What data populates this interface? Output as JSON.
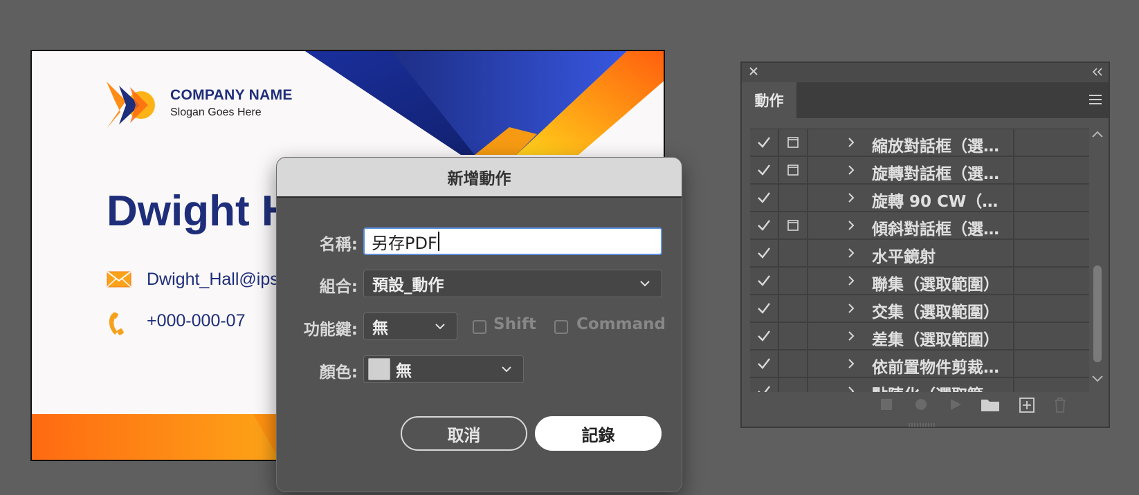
{
  "card": {
    "company_name": "COMPANY NAME",
    "slogan": "Slogan Goes Here",
    "person_name": "Dwight H",
    "email": "Dwight_Hall@ips",
    "phone": "+000-000-07",
    "icons": [
      "brand-logo",
      "mail-icon",
      "phone-icon"
    ],
    "colors": {
      "navy": "#1f2e7a",
      "orange": "#ff6d12",
      "yellow": "#fcc318",
      "blue": "#2b47cf"
    }
  },
  "dialog": {
    "title": "新增動作",
    "name_label": "名稱:",
    "name_value": "另存PDF",
    "set_label": "組合:",
    "set_value": "預設_動作",
    "function_key_label": "功能鍵:",
    "function_key_value": "無",
    "shift_label": "Shift",
    "command_label": "Command",
    "color_label": "顏色:",
    "color_value": "無",
    "cancel_label": "取消",
    "record_label": "記錄"
  },
  "panel": {
    "tab_label": "動作",
    "rows": [
      {
        "label": "縮放對話框（選…",
        "has_dialog_toggle": true
      },
      {
        "label": "旋轉對話框（選…",
        "has_dialog_toggle": true
      },
      {
        "label": "旋轉 90 CW（…",
        "has_dialog_toggle": false
      },
      {
        "label": "傾斜對話框（選…",
        "has_dialog_toggle": true
      },
      {
        "label": "水平鏡射",
        "has_dialog_toggle": false
      },
      {
        "label": "聯集（選取範圍）",
        "has_dialog_toggle": false
      },
      {
        "label": "交集（選取範圍）",
        "has_dialog_toggle": false
      },
      {
        "label": "差集（選取範圍）",
        "has_dialog_toggle": false
      },
      {
        "label": "依前置物件剪裁…",
        "has_dialog_toggle": false
      },
      {
        "label": "點陣化（選取範…",
        "has_dialog_toggle": false
      }
    ],
    "footer_icons": [
      "stop-icon",
      "record-icon",
      "play-icon",
      "folder-icon",
      "new-action-icon",
      "trash-icon"
    ]
  }
}
